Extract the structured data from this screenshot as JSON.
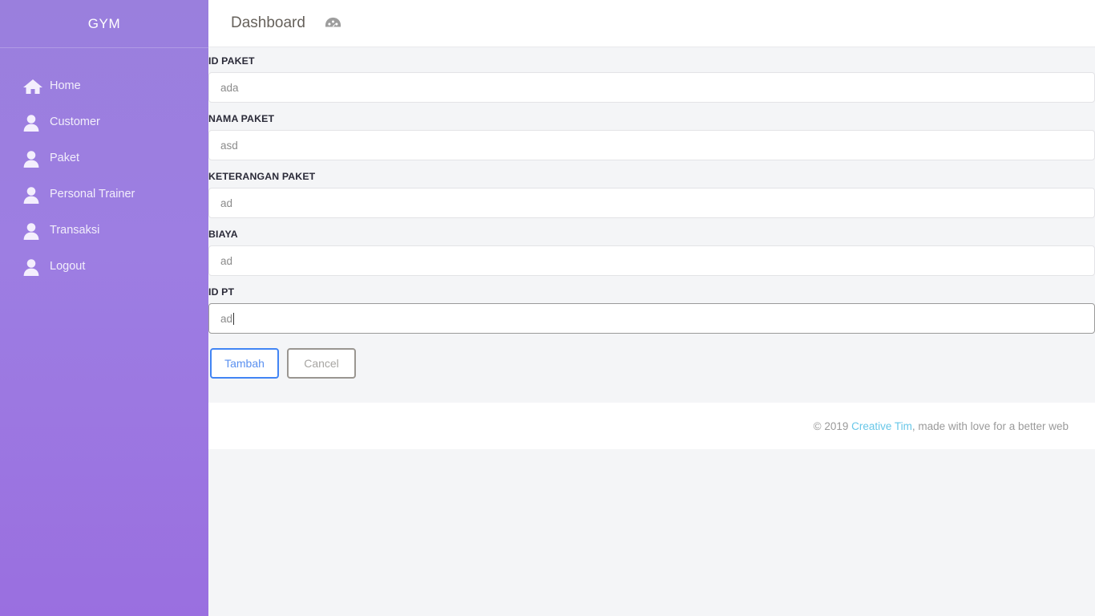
{
  "sidebar": {
    "brand": "GYM",
    "items": [
      {
        "label": "Home",
        "icon": "home-icon"
      },
      {
        "label": "Customer",
        "icon": "user-icon"
      },
      {
        "label": "Paket",
        "icon": "user-icon"
      },
      {
        "label": "Personal Trainer",
        "icon": "user-icon"
      },
      {
        "label": "Transaksi",
        "icon": "user-icon"
      },
      {
        "label": "Logout",
        "icon": "user-icon"
      }
    ],
    "background_color": "#9a7fdd",
    "text_color": "#f2eefb"
  },
  "topbar": {
    "title": "Dashboard",
    "icon": "tachometer-dashboard-icon",
    "icon_color": "#9a9a9a"
  },
  "form": {
    "fields": [
      {
        "label": "ID PAKET",
        "value": "ada",
        "focused": false
      },
      {
        "label": "NAMA PAKET",
        "value": "asd",
        "focused": false
      },
      {
        "label": "KETERANGAN PAKET",
        "value": "ad",
        "focused": false
      },
      {
        "label": "BIAYA",
        "value": "ad",
        "focused": false
      },
      {
        "label": "ID PT",
        "value": "ad",
        "focused": true
      }
    ],
    "submit_label": "Tambah",
    "cancel_label": "Cancel",
    "submit_color": "#4285f4",
    "cancel_color": "#9a9691"
  },
  "footer": {
    "copyright": "© 2019 ",
    "link": "Creative Tim",
    "tail": ", made with love for a better web",
    "link_color": "#68c7e8"
  }
}
